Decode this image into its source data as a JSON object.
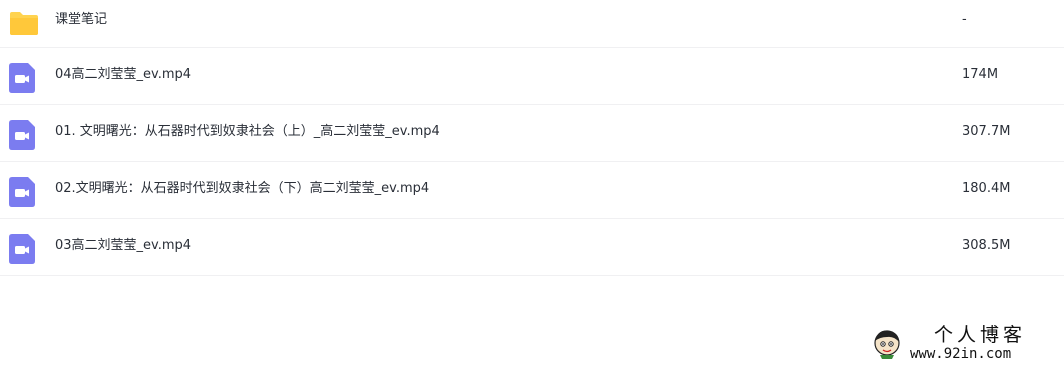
{
  "files": [
    {
      "name": "课堂笔记",
      "size": "-",
      "icon": "folder-icon"
    },
    {
      "name": "04高二刘莹莹_ev.mp4",
      "size": "174M",
      "icon": "video-file-icon"
    },
    {
      "name": "01. 文明曙光：从石器时代到奴隶社会（上）_高二刘莹莹_ev.mp4",
      "size": "307.7M",
      "icon": "video-file-icon"
    },
    {
      "name": "02.文明曙光：从石器时代到奴隶社会（下）高二刘莹莹_ev.mp4",
      "size": "180.4M",
      "icon": "video-file-icon"
    },
    {
      "name": "03高二刘莹莹_ev.mp4",
      "size": "308.5M",
      "icon": "video-file-icon"
    }
  ],
  "colors": {
    "folder": "#ffd34f",
    "video_icon": "#7b7cf0",
    "text": "#2a2f38",
    "divider": "#f0f0f2"
  },
  "watermark": {
    "title": "个人博客",
    "url": "www.92in.com"
  }
}
